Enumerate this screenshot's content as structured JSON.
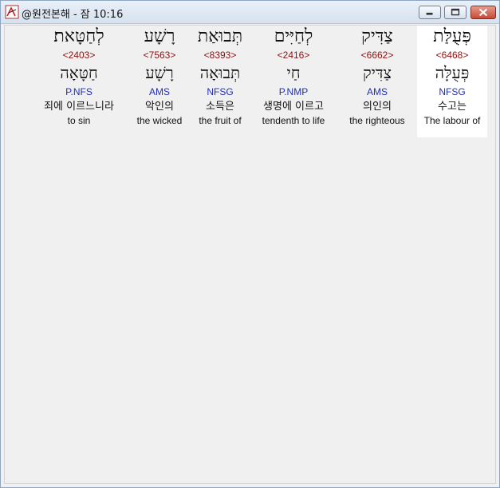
{
  "window": {
    "title": "@원전본해 - 잠 10:16",
    "icon": "book-icon"
  },
  "words": [
    {
      "hebrew": "פְּעֻלַּת",
      "strong": "<6468>",
      "lemma": "פְּעֻלָּה",
      "morph": "NFSG",
      "korean": "수고는",
      "english": "The labour of"
    },
    {
      "hebrew": "צַדִּיק",
      "strong": "<6662>",
      "lemma": "צַדִּיק",
      "morph": "AMS",
      "korean": "의인의",
      "english": "the righteous"
    },
    {
      "hebrew": "לְחַיִּים",
      "strong": "<2416>",
      "lemma": "חַי",
      "morph": "P.NMP",
      "korean": "생명에 이르고",
      "english": "tendenth to life"
    },
    {
      "hebrew": "תְּבוּאַת",
      "strong": "<8393>",
      "lemma": "תְּבוּאָה",
      "morph": "NFSG",
      "korean": "소득은",
      "english": "the fruit of"
    },
    {
      "hebrew": "רָשָׁע",
      "strong": "<7563>",
      "lemma": "רָשָׁע",
      "morph": "AMS",
      "korean": "악인의",
      "english": "the wicked"
    },
    {
      "hebrew": "לְחַטָּאת׃",
      "strong": "<2403>",
      "lemma": "חַטָּאָה",
      "morph": "P.NFS",
      "korean": "죄에 이르느니라",
      "english": "to sin"
    }
  ]
}
